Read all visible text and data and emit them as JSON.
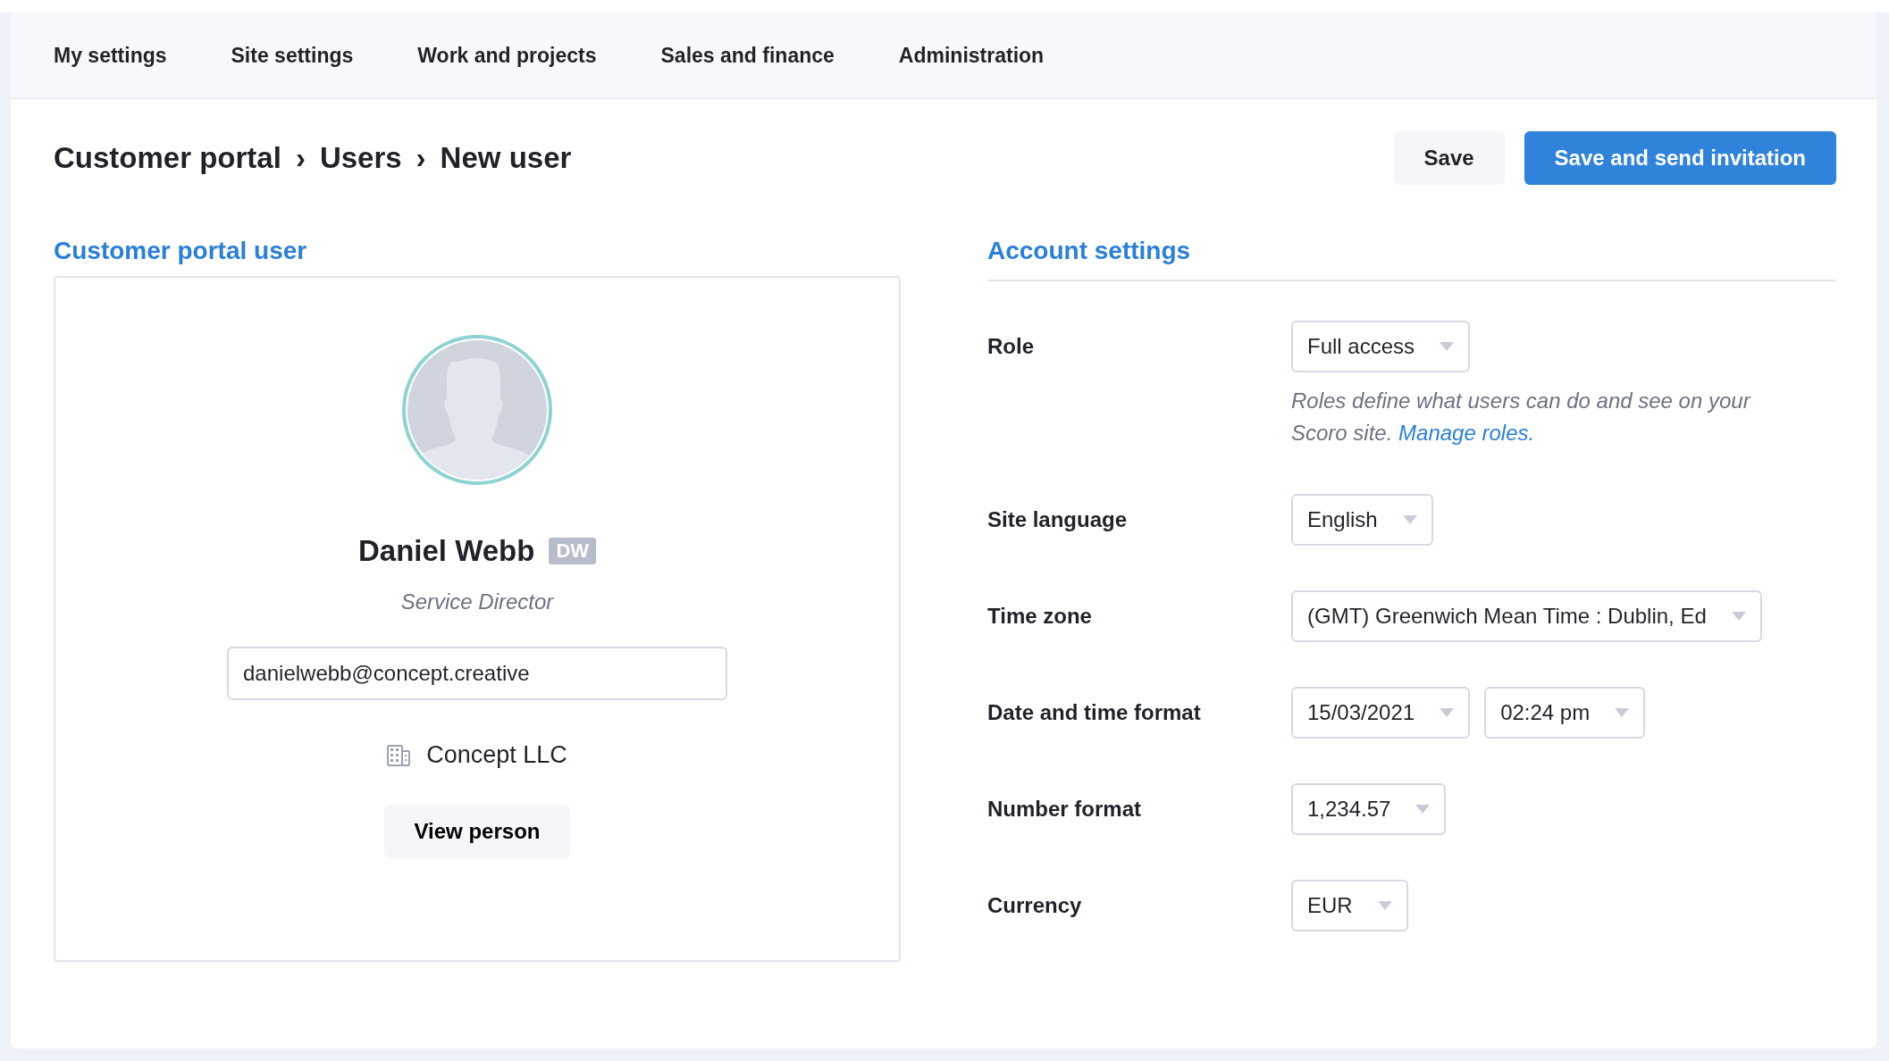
{
  "nav": {
    "tabs": [
      {
        "label": "My settings"
      },
      {
        "label": "Site settings"
      },
      {
        "label": "Work and projects"
      },
      {
        "label": "Sales and finance"
      },
      {
        "label": "Administration"
      }
    ]
  },
  "breadcrumb": [
    "Customer portal",
    "Users",
    "New user"
  ],
  "breadcrumb_separator": "›",
  "buttons": [
    {
      "label": "Save",
      "kind": "secondary"
    },
    {
      "label": "Save and send invitation",
      "kind": "primary"
    }
  ],
  "user_panel": {
    "title": "Customer portal user",
    "name": "Daniel Webb",
    "initials": "DW",
    "job_title": "Service Director",
    "email": "danielwebb@concept.creative",
    "company": "Concept LLC",
    "button": "View person"
  },
  "account_settings": {
    "title": "Account settings",
    "rows": [
      {
        "label": "Role",
        "selects": [
          "Full access"
        ],
        "hint": "Roles define what users can do and see on your Scoro site.",
        "hint_link": "Manage roles."
      },
      {
        "label": "Site language",
        "selects": [
          "English"
        ]
      },
      {
        "label": "Time zone",
        "selects": [
          "(GMT) Greenwich Mean Time : Dublin, Ed"
        ]
      },
      {
        "label": "Date and time format",
        "selects": [
          "15/03/2021",
          "02:24 pm"
        ]
      },
      {
        "label": "Number format",
        "selects": [
          "1,234.57"
        ]
      },
      {
        "label": "Currency",
        "selects": [
          "EUR"
        ]
      }
    ]
  }
}
